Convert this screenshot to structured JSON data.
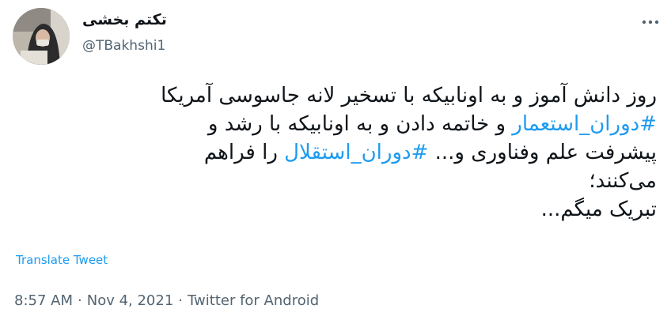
{
  "user": {
    "display_name": "تکتم بخشی",
    "handle": "@TBakhshi1",
    "avatar": "avatar-photo"
  },
  "tweet": {
    "line1": "روز دانش آموز و به اونابیکه با تسخیر لانه جاسوسی آمریکا",
    "hashtag1": "#دوران_استعمار",
    "line2_rest": " و خاتمه دادن و به اونابیکه با رشد و",
    "line3_start": "پیشرفت علم وفناوری و... ",
    "hashtag2": "#دوران_استقلال",
    "line3_end": " را فراهم",
    "line4": "می‌کنند؛",
    "line5": "تبریک میگم..."
  },
  "actions": {
    "translate_label": "Translate Tweet",
    "more_icon": "more-horizontal-icon"
  },
  "meta": {
    "time": "8:57 AM",
    "separator1": "·",
    "date": "Nov 4, 2021",
    "separator2": "·",
    "source": "Twitter for Android"
  },
  "colors": {
    "link": "#1d9bf0",
    "secondary_text": "#536471",
    "primary_text": "#0f1419"
  }
}
